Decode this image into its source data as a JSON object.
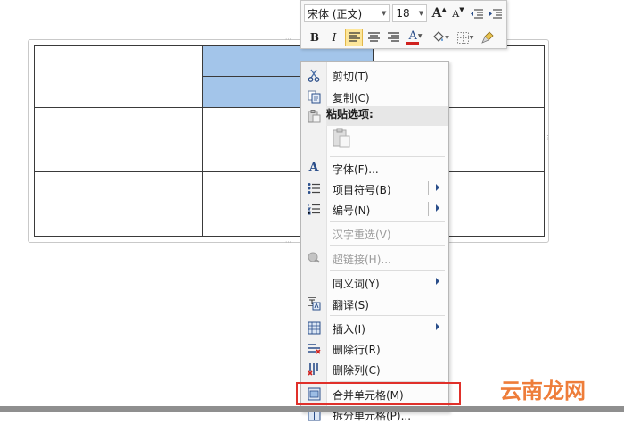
{
  "mini_toolbar": {
    "font_name": "宋体 (正文)",
    "font_size": "18",
    "bold_label": "B",
    "italic_label": "I",
    "font_color_label": "A",
    "grow_font_label": "A",
    "shrink_font_label": "A"
  },
  "context_menu": {
    "items": [
      {
        "label": "剪切(T)",
        "icon": "scissors-icon",
        "enabled": true
      },
      {
        "label": "复制(C)",
        "icon": "copy-icon",
        "enabled": true
      },
      {
        "label": "粘贴选项:",
        "icon": "paste-icon",
        "enabled": true,
        "header": true
      },
      {
        "label": "字体(F)...",
        "icon": "font-icon",
        "enabled": true
      },
      {
        "label": "项目符号(B)",
        "icon": "bullets-icon",
        "enabled": true,
        "submenu": true
      },
      {
        "label": "编号(N)",
        "icon": "numbering-icon",
        "enabled": true,
        "submenu": true
      },
      {
        "label": "汉字重选(V)",
        "icon": "",
        "enabled": false
      },
      {
        "label": "超链接(H)...",
        "icon": "hyperlink-icon",
        "enabled": false
      },
      {
        "label": "同义词(Y)",
        "icon": "",
        "enabled": true,
        "submenu": true
      },
      {
        "label": "翻译(S)",
        "icon": "translate-icon",
        "enabled": true
      },
      {
        "label": "插入(I)",
        "icon": "insert-table-icon",
        "enabled": true,
        "submenu": true
      },
      {
        "label": "删除行(R)",
        "icon": "delete-row-icon",
        "enabled": true
      },
      {
        "label": "删除列(C)",
        "icon": "delete-column-icon",
        "enabled": true
      },
      {
        "label": "合并单元格(M)",
        "icon": "merge-cells-icon",
        "enabled": true,
        "highlighted": true
      },
      {
        "label": "拆分单元格(P)...",
        "icon": "split-cells-icon",
        "enabled": true
      }
    ]
  },
  "watermark": "云南龙网",
  "colors": {
    "selection": "#a3c5ea",
    "highlight_box": "#e0302a",
    "font_color_bar": "#d0221f",
    "submenu_arrow": "#2a4e8a"
  }
}
